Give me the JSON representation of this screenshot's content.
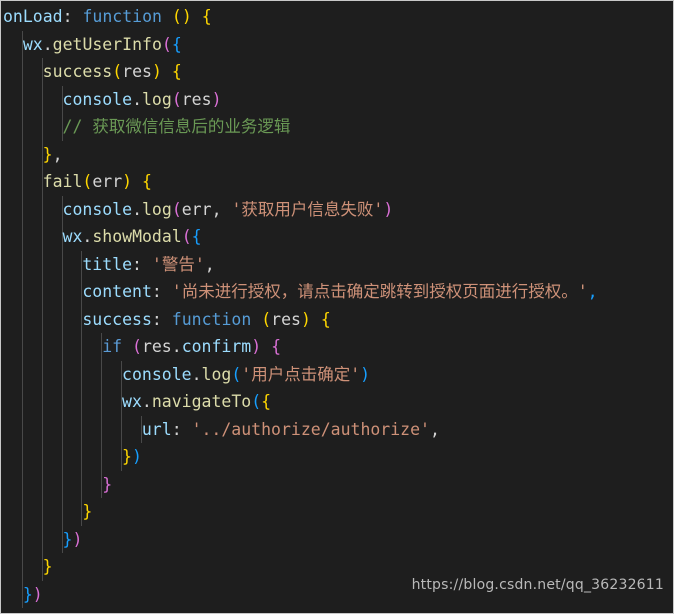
{
  "editor": {
    "name": "code-editor",
    "language": "javascript",
    "theme": "dark-plus",
    "background_color": "#1e1e1e",
    "foreground_color": "#d4d4d4",
    "border_color": "#c8c8c8",
    "indent_guide_color": "#494949",
    "font_size_px": 16.5,
    "line_height_px": 27.5
  },
  "colors": {
    "keyword": "#569cd6",
    "control": "#5b9bd5",
    "string": "#ce9178",
    "comment": "#6a9955",
    "property": "#9cdcfe",
    "function": "#dcdcaa",
    "plain": "#d4d4d4",
    "bracket_level_1": "#ffd700",
    "bracket_level_2": "#da70d6",
    "bracket_level_3": "#179fff"
  },
  "watermark": {
    "text": "https://blog.csdn.net/qq_36232611"
  },
  "code": {
    "lines": [
      {
        "indent": 0,
        "tokens": [
          {
            "t": "onLoad",
            "c": "t-prop"
          },
          {
            "t": ": ",
            "c": "t-punc"
          },
          {
            "t": "function",
            "c": "t-kw"
          },
          {
            "t": " ",
            "c": "t-plain"
          },
          {
            "t": "()",
            "c": "b1"
          },
          {
            "t": " ",
            "c": "t-plain"
          },
          {
            "t": "{",
            "c": "b1"
          }
        ]
      },
      {
        "indent": 1,
        "tokens": [
          {
            "t": "wx",
            "c": "t-prop"
          },
          {
            "t": ".",
            "c": "t-punc"
          },
          {
            "t": "getUserInfo",
            "c": "t-fn"
          },
          {
            "t": "(",
            "c": "b2"
          },
          {
            "t": "{",
            "c": "b3"
          }
        ]
      },
      {
        "indent": 2,
        "tokens": [
          {
            "t": "success",
            "c": "t-fn"
          },
          {
            "t": "(",
            "c": "b1"
          },
          {
            "t": "res",
            "c": "t-plain"
          },
          {
            "t": ")",
            "c": "b1"
          },
          {
            "t": " ",
            "c": "t-plain"
          },
          {
            "t": "{",
            "c": "b1"
          }
        ]
      },
      {
        "indent": 3,
        "tokens": [
          {
            "t": "console",
            "c": "t-prop"
          },
          {
            "t": ".",
            "c": "t-punc"
          },
          {
            "t": "log",
            "c": "t-fn"
          },
          {
            "t": "(",
            "c": "b2"
          },
          {
            "t": "res",
            "c": "t-plain"
          },
          {
            "t": ")",
            "c": "b2"
          }
        ]
      },
      {
        "indent": 3,
        "tokens": [
          {
            "t": "// ",
            "c": "t-comment"
          },
          {
            "t": "获取微信信息后的业务逻辑",
            "c": "t-comment cjk"
          }
        ]
      },
      {
        "indent": 2,
        "tokens": [
          {
            "t": "}",
            "c": "b1"
          },
          {
            "t": ",",
            "c": "t-punc"
          }
        ]
      },
      {
        "indent": 2,
        "tokens": [
          {
            "t": "fail",
            "c": "t-fn"
          },
          {
            "t": "(",
            "c": "b1"
          },
          {
            "t": "err",
            "c": "t-plain"
          },
          {
            "t": ")",
            "c": "b1"
          },
          {
            "t": " ",
            "c": "t-plain"
          },
          {
            "t": "{",
            "c": "b1"
          }
        ]
      },
      {
        "indent": 3,
        "tokens": [
          {
            "t": "console",
            "c": "t-prop"
          },
          {
            "t": ".",
            "c": "t-punc"
          },
          {
            "t": "log",
            "c": "t-fn"
          },
          {
            "t": "(",
            "c": "b2"
          },
          {
            "t": "err",
            "c": "t-plain"
          },
          {
            "t": ", ",
            "c": "t-punc"
          },
          {
            "t": "'",
            "c": "t-str"
          },
          {
            "t": "获取用户信息失败",
            "c": "t-str cjk"
          },
          {
            "t": "'",
            "c": "t-str"
          },
          {
            "t": ")",
            "c": "b2"
          }
        ]
      },
      {
        "indent": 3,
        "tokens": [
          {
            "t": "wx",
            "c": "t-prop"
          },
          {
            "t": ".",
            "c": "t-punc"
          },
          {
            "t": "showModal",
            "c": "t-fn"
          },
          {
            "t": "(",
            "c": "b2"
          },
          {
            "t": "{",
            "c": "b3"
          }
        ]
      },
      {
        "indent": 4,
        "tokens": [
          {
            "t": "title",
            "c": "t-prop"
          },
          {
            "t": ": ",
            "c": "t-punc"
          },
          {
            "t": "'",
            "c": "t-str"
          },
          {
            "t": "警告",
            "c": "t-str cjk"
          },
          {
            "t": "'",
            "c": "t-str"
          },
          {
            "t": ",",
            "c": "t-punc"
          }
        ]
      },
      {
        "indent": 4,
        "tokens": [
          {
            "t": "content",
            "c": "t-prop"
          },
          {
            "t": ": ",
            "c": "t-punc"
          },
          {
            "t": "'",
            "c": "t-str"
          },
          {
            "t": "尚未进行授权，请点击确定跳转到授权页面进行授权。",
            "c": "t-str cjk"
          },
          {
            "t": "'",
            "c": "t-str"
          },
          {
            "t": ",",
            "c": "b3"
          }
        ]
      },
      {
        "indent": 4,
        "tokens": [
          {
            "t": "success",
            "c": "t-prop"
          },
          {
            "t": ": ",
            "c": "t-punc"
          },
          {
            "t": "function",
            "c": "t-kw"
          },
          {
            "t": " ",
            "c": "t-plain"
          },
          {
            "t": "(",
            "c": "b1"
          },
          {
            "t": "res",
            "c": "t-plain"
          },
          {
            "t": ")",
            "c": "b1"
          },
          {
            "t": " ",
            "c": "t-plain"
          },
          {
            "t": "{",
            "c": "b1"
          }
        ]
      },
      {
        "indent": 5,
        "tokens": [
          {
            "t": "if",
            "c": "t-ctrl"
          },
          {
            "t": " ",
            "c": "t-plain"
          },
          {
            "t": "(",
            "c": "b2"
          },
          {
            "t": "res",
            "c": "t-plain"
          },
          {
            "t": ".",
            "c": "t-punc"
          },
          {
            "t": "confirm",
            "c": "t-prop"
          },
          {
            "t": ")",
            "c": "b2"
          },
          {
            "t": " ",
            "c": "t-plain"
          },
          {
            "t": "{",
            "c": "b2"
          }
        ]
      },
      {
        "indent": 6,
        "tokens": [
          {
            "t": "console",
            "c": "t-prop"
          },
          {
            "t": ".",
            "c": "t-punc"
          },
          {
            "t": "log",
            "c": "t-fn"
          },
          {
            "t": "(",
            "c": "b3"
          },
          {
            "t": "'",
            "c": "t-str"
          },
          {
            "t": "用户点击确定",
            "c": "t-str cjk"
          },
          {
            "t": "'",
            "c": "t-str"
          },
          {
            "t": ")",
            "c": "b3"
          }
        ]
      },
      {
        "indent": 6,
        "tokens": [
          {
            "t": "wx",
            "c": "t-prop"
          },
          {
            "t": ".",
            "c": "t-punc"
          },
          {
            "t": "navigateTo",
            "c": "t-fn"
          },
          {
            "t": "(",
            "c": "b3"
          },
          {
            "t": "{",
            "c": "b1"
          }
        ]
      },
      {
        "indent": 7,
        "tokens": [
          {
            "t": "url",
            "c": "t-prop"
          },
          {
            "t": ": ",
            "c": "t-punc"
          },
          {
            "t": "'",
            "c": "t-str"
          },
          {
            "t": "../authorize/authorize",
            "c": "t-str"
          },
          {
            "t": "'",
            "c": "t-str"
          },
          {
            "t": ",",
            "c": "t-punc"
          }
        ]
      },
      {
        "indent": 6,
        "tokens": [
          {
            "t": "}",
            "c": "b1"
          },
          {
            "t": ")",
            "c": "b3"
          }
        ]
      },
      {
        "indent": 5,
        "tokens": [
          {
            "t": "}",
            "c": "b2"
          }
        ]
      },
      {
        "indent": 4,
        "tokens": [
          {
            "t": "}",
            "c": "b1"
          }
        ]
      },
      {
        "indent": 3,
        "tokens": [
          {
            "t": "}",
            "c": "b3"
          },
          {
            "t": ")",
            "c": "b2"
          }
        ]
      },
      {
        "indent": 2,
        "tokens": [
          {
            "t": "}",
            "c": "b1"
          }
        ]
      },
      {
        "indent": 1,
        "tokens": [
          {
            "t": "}",
            "c": "b3"
          },
          {
            "t": ")",
            "c": "b2"
          }
        ]
      }
    ]
  }
}
